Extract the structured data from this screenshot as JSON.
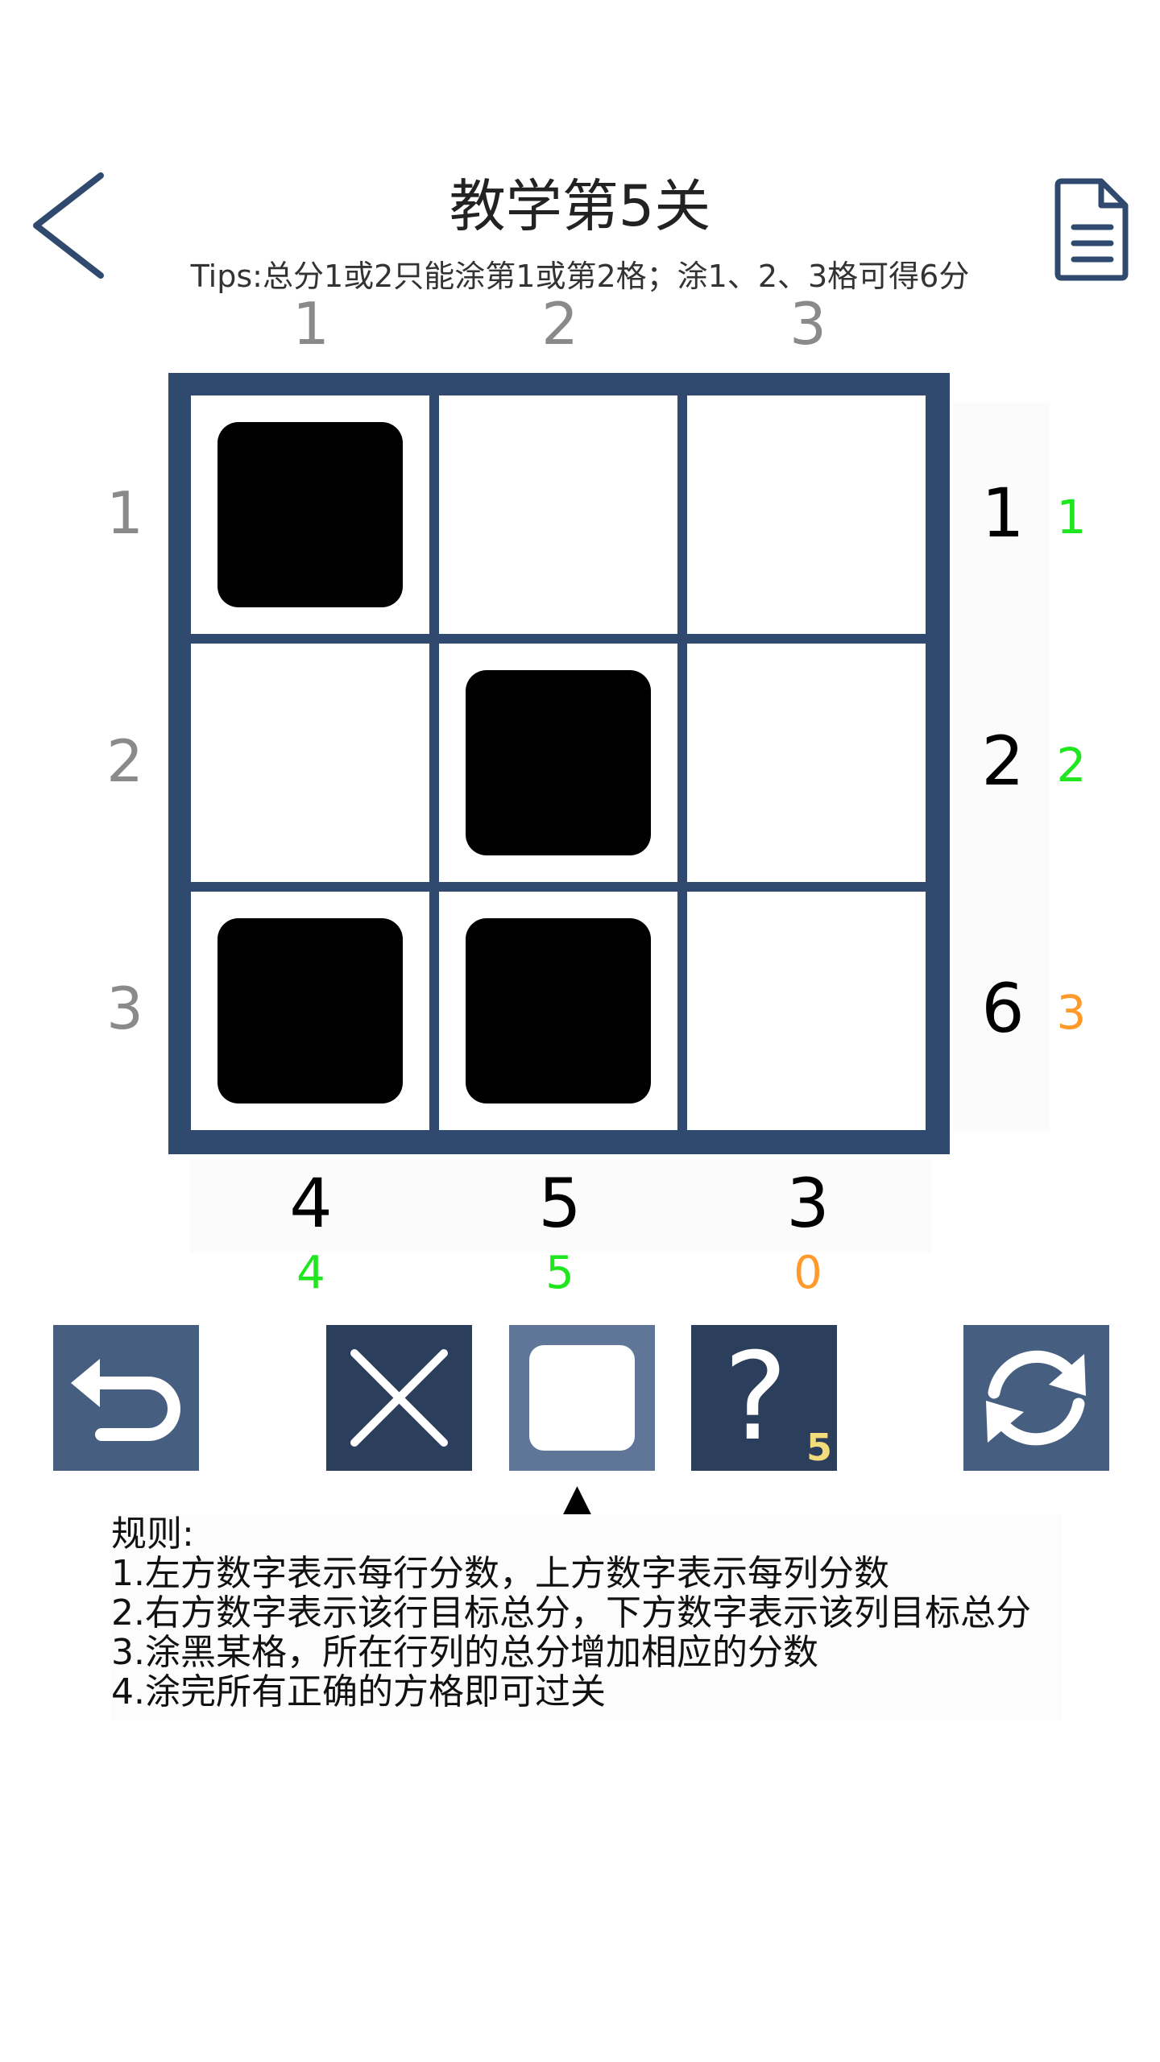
{
  "header": {
    "title": "教学第5关",
    "tips": "Tips:总分1或2只能涂第1或第2格；涂1、2、3格可得6分"
  },
  "column_headers": [
    "1",
    "2",
    "3"
  ],
  "row_headers": [
    "1",
    "2",
    "3"
  ],
  "grid": {
    "rows": 3,
    "cols": 3,
    "filled": [
      [
        true,
        false,
        false
      ],
      [
        false,
        true,
        false
      ],
      [
        true,
        true,
        false
      ]
    ]
  },
  "row_targets": [
    "1",
    "2",
    "6"
  ],
  "row_current": [
    "1",
    "2",
    "3"
  ],
  "column_targets": [
    "4",
    "5",
    "3"
  ],
  "column_current": [
    "4",
    "5",
    "0"
  ],
  "status_colors": {
    "match": "#1fe61f",
    "mismatch": "#ff9a2b"
  },
  "row_status": [
    "match",
    "match",
    "mismatch"
  ],
  "column_status": [
    "match",
    "match",
    "mismatch"
  ],
  "toolbar": {
    "undo_icon": "undo-arrow-icon",
    "cross_icon": "cross-icon",
    "fill_icon": "fill-square-icon",
    "hint_icon": "question-mark-icon",
    "hint_label": "?",
    "hint_count": "5",
    "refresh_icon": "refresh-icon",
    "selected_tool": "fill",
    "selector_glyph": "▲"
  },
  "rules": {
    "heading": "规则:",
    "items": [
      "1.左方数字表示每行分数，上方数字表示每列分数",
      "2.右方数字表示该行目标总分，下方数字表示该列目标总分",
      "3.涂黑某格，所在行列的总分增加相应的分数",
      "4.涂完所有正确的方格即可过关"
    ]
  },
  "colors": {
    "board": "#2f4a6e",
    "header_numbers": "#8a8a8a",
    "icon": "#2f4a6e"
  }
}
